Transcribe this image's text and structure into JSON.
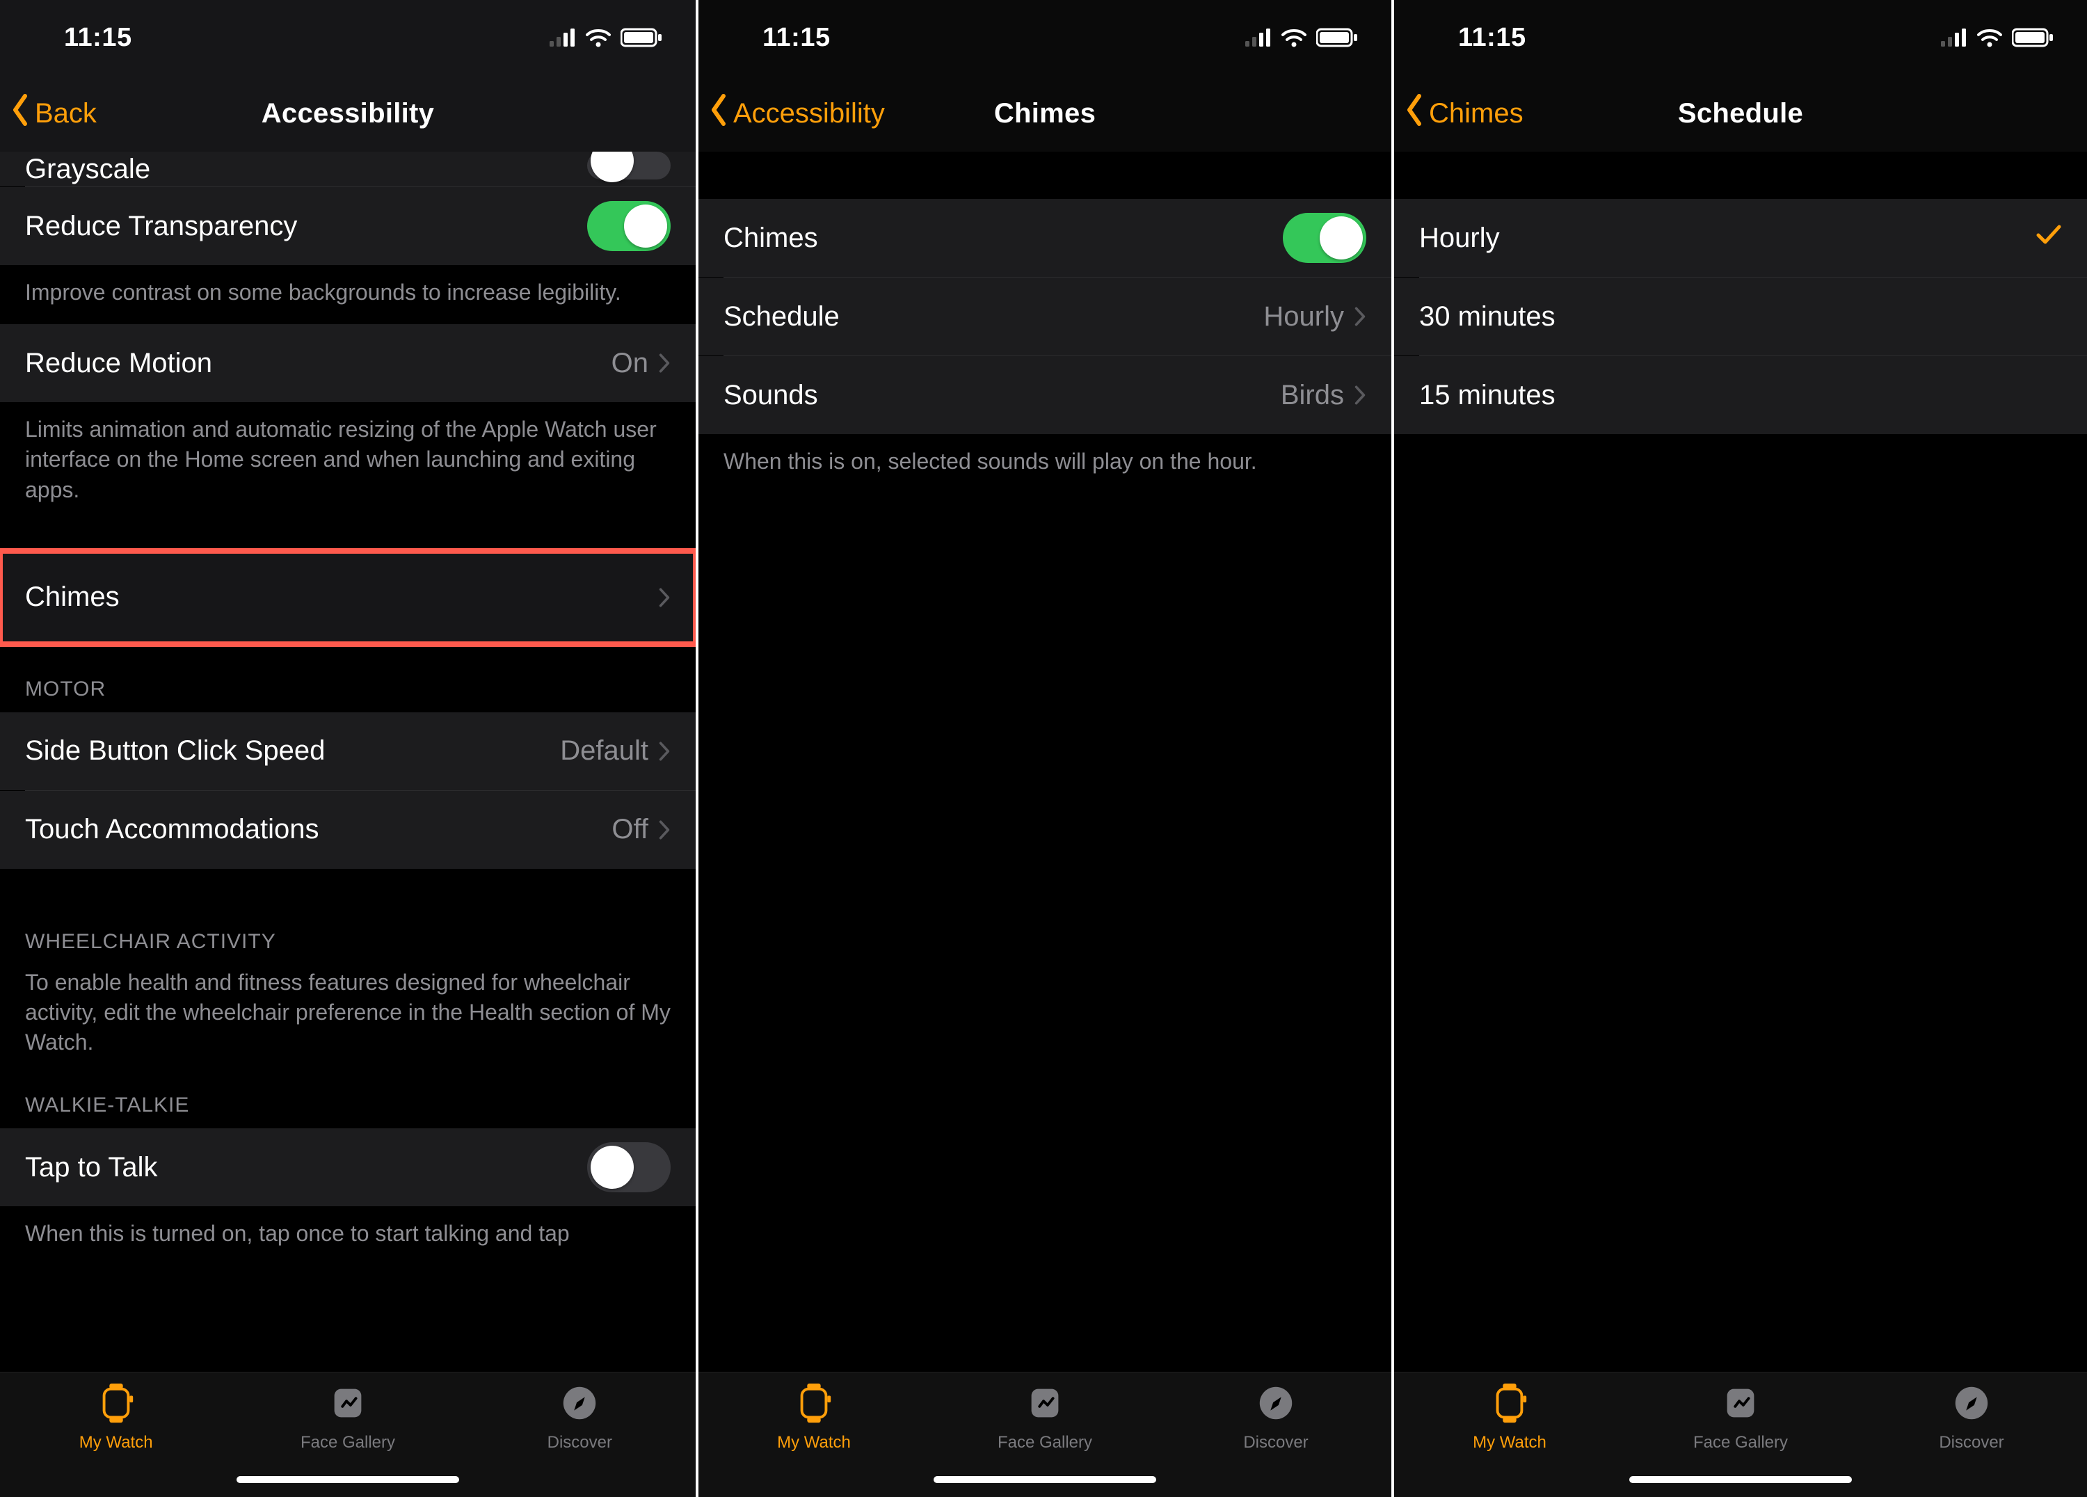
{
  "status": {
    "time": "11:15"
  },
  "tabs": {
    "my_watch": "My Watch",
    "face_gallery": "Face Gallery",
    "discover": "Discover"
  },
  "screen1": {
    "back": "Back",
    "title": "Accessibility",
    "grayscale_label": "Grayscale",
    "reduce_transparency_label": "Reduce Transparency",
    "reduce_transparency_note": "Improve contrast on some backgrounds to increase legibility.",
    "reduce_motion_label": "Reduce Motion",
    "reduce_motion_value": "On",
    "reduce_motion_note": "Limits animation and automatic resizing of the Apple Watch user interface on the Home screen and when launching and exiting apps.",
    "chimes_label": "Chimes",
    "section_motor": "MOTOR",
    "side_button_label": "Side Button Click Speed",
    "side_button_value": "Default",
    "touch_accommodations_label": "Touch Accommodations",
    "touch_accommodations_value": "Off",
    "section_wheelchair": "WHEELCHAIR ACTIVITY",
    "wheelchair_note": "To enable health and fitness features designed for wheelchair activity, edit the wheelchair preference in the Health section of My Watch.",
    "section_walkie": "WALKIE-TALKIE",
    "tap_to_talk_label": "Tap to Talk",
    "tap_to_talk_note": "When this is turned on, tap once to start talking and tap"
  },
  "screen2": {
    "back": "Accessibility",
    "title": "Chimes",
    "chimes_label": "Chimes",
    "schedule_label": "Schedule",
    "schedule_value": "Hourly",
    "sounds_label": "Sounds",
    "sounds_value": "Birds",
    "note": "When this is on, selected sounds will play on the hour."
  },
  "screen3": {
    "back": "Chimes",
    "title": "Schedule",
    "options": {
      "hourly": "Hourly",
      "thirty": "30 minutes",
      "fifteen": "15 minutes"
    },
    "selected": "hourly"
  }
}
